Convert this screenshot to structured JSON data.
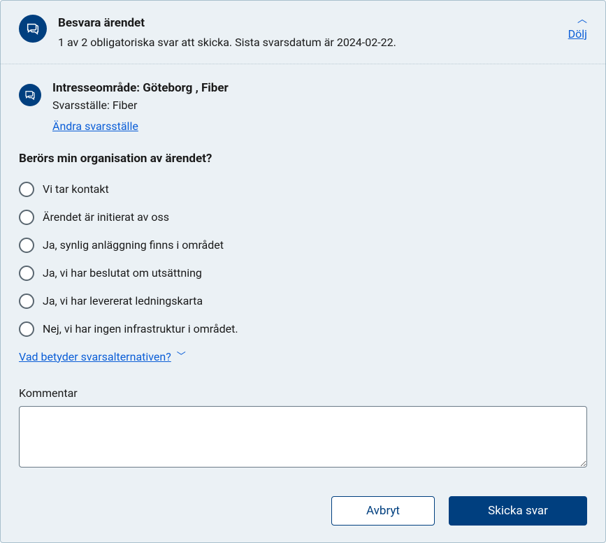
{
  "header": {
    "title": "Besvara ärendet",
    "subtitle": "1 av 2 obligatoriska svar att skicka. Sista svarsdatum är 2024-02-22.",
    "hide_label": "Dölj"
  },
  "subheader": {
    "title": "Intresseområde: Göteborg , Fiber",
    "line": "Svarsställe: Fiber",
    "change_link": "Ändra svarsställe"
  },
  "question": "Berörs min organisation av ärendet?",
  "options": [
    "Vi tar kontakt",
    "Ärendet är initierat av oss",
    "Ja, synlig anläggning finns i området",
    "Ja, vi har beslutat om utsättning",
    "Ja, vi har levererat ledningskarta",
    "Nej, vi har ingen infrastruktur i området."
  ],
  "help_link": "Vad betyder svarsalternativen?",
  "comment_label": "Kommentar",
  "buttons": {
    "cancel": "Avbryt",
    "submit": "Skicka svar"
  }
}
